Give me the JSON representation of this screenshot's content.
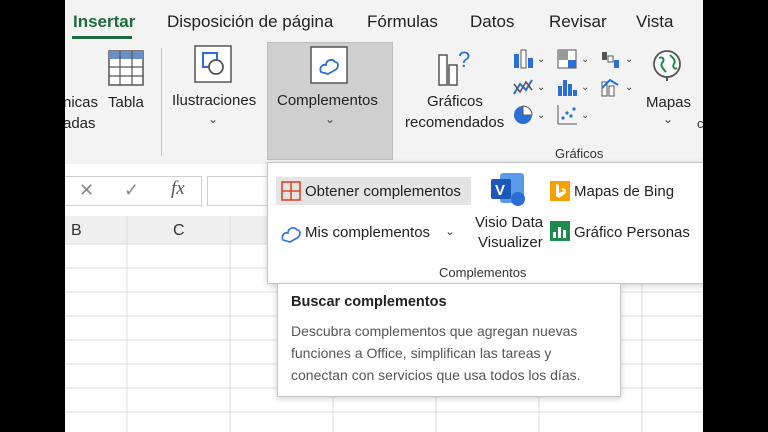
{
  "tabs": [
    "Insertar",
    "Disposición de página",
    "Fórmulas",
    "Datos",
    "Revisar",
    "Vista"
  ],
  "ribbon": {
    "partial_label_1": "nicas",
    "partial_label_2": "adas",
    "tabla": "Tabla",
    "ilustraciones": "Ilustraciones",
    "complementos": "Complementos",
    "graficos_line1": "Gráficos",
    "graficos_line2": "recomendados",
    "mapas": "Mapas",
    "graficos_group": "Gráficos",
    "edge_letter": "c"
  },
  "formula_bar": {
    "cancel": "✕",
    "enter": "✓",
    "fx": "fx"
  },
  "columns": [
    "B",
    "C"
  ],
  "dropdown": {
    "obtener": "Obtener complementos",
    "mis": "Mis complementos",
    "visio_line1": "Visio Data",
    "visio_line2": "Visualizer",
    "bing": "Mapas de Bing",
    "personas": "Gráfico Personas",
    "group_label": "Complementos"
  },
  "tooltip": {
    "title": "Buscar complementos",
    "line1": "Descubra complementos que agregan nuevas",
    "line2": "funciones a Office, simplifican las tareas y",
    "line3": "conectan con servicios que usa todos los días."
  },
  "colors": {
    "accent_green": "#1e6b3f",
    "bing_orange": "#f5a100",
    "visio_blue": "#2b6fd6",
    "addin_red": "#d9482b"
  }
}
